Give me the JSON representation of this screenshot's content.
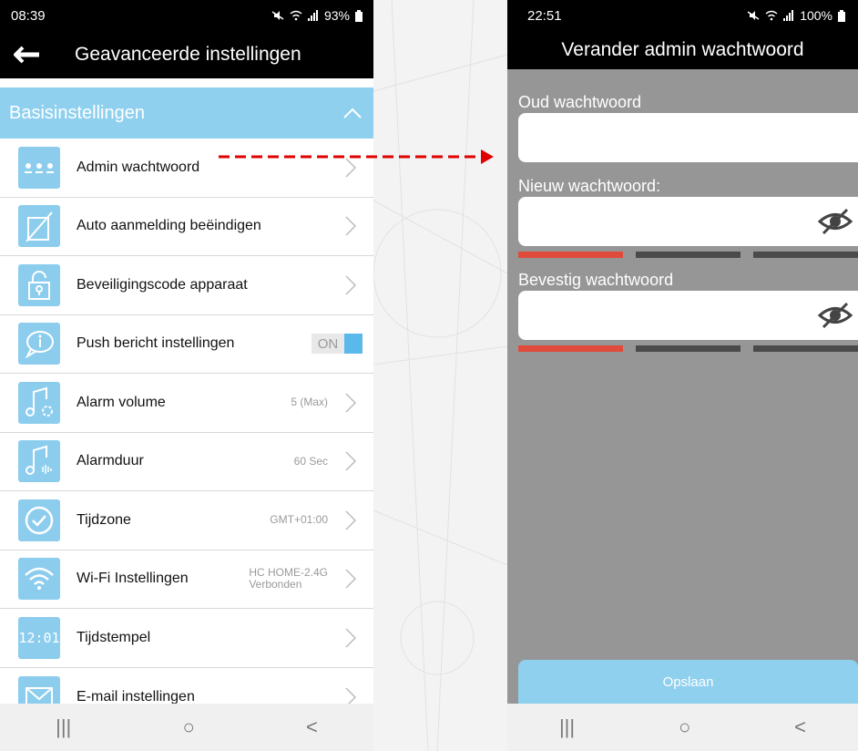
{
  "left": {
    "status": {
      "time": "08:39",
      "battery": "93%"
    },
    "header": {
      "title": "Geavanceerde instellingen"
    },
    "section": {
      "title": "Basisinstellingen"
    },
    "items": [
      {
        "label": "Admin wachtwoord",
        "value": "",
        "icon": "dots-icon"
      },
      {
        "label": "Auto aanmelding beëindigen",
        "value": "",
        "icon": "no-login-icon"
      },
      {
        "label": "Beveiligingscode apparaat",
        "value": "",
        "icon": "lock-icon"
      },
      {
        "label": "Push bericht instellingen",
        "value": "ON",
        "icon": "message-icon"
      },
      {
        "label": "Alarm volume",
        "value": "5 (Max)",
        "icon": "music-gear-icon"
      },
      {
        "label": "Alarmduur",
        "value": "60 Sec",
        "icon": "music-duration-icon"
      },
      {
        "label": "Tijdzone",
        "value": "GMT+01:00",
        "icon": "clock-check-icon"
      },
      {
        "label": "Wi-Fi Instellingen",
        "value": "HC HOME-2.4G",
        "value2": "Verbonden",
        "icon": "wifi-icon"
      },
      {
        "label": "Tijdstempel",
        "value": "",
        "icon": "digital-clock-icon"
      },
      {
        "label": "E-mail instellingen",
        "value": "",
        "icon": "email-icon"
      }
    ],
    "timestamp_icon_text": "12:01"
  },
  "right": {
    "status": {
      "time": "22:51",
      "battery": "100%"
    },
    "header": {
      "title": "Verander admin wachtwoord"
    },
    "fields": {
      "old": {
        "label": "Oud wachtwoord",
        "value": ""
      },
      "new": {
        "label": "Nieuw wachtwoord:",
        "value": ""
      },
      "confirm": {
        "label": "Bevestig wachtwoord",
        "value": ""
      }
    },
    "save_label": "Opslaan"
  },
  "nav": {
    "recent": "|||",
    "home": "○",
    "back": "<"
  },
  "colors": {
    "accent": "#8fd0ef",
    "icon_bg": "#8ccdee",
    "arrow": "#e00000",
    "strength_weak": "#e04b3b"
  }
}
